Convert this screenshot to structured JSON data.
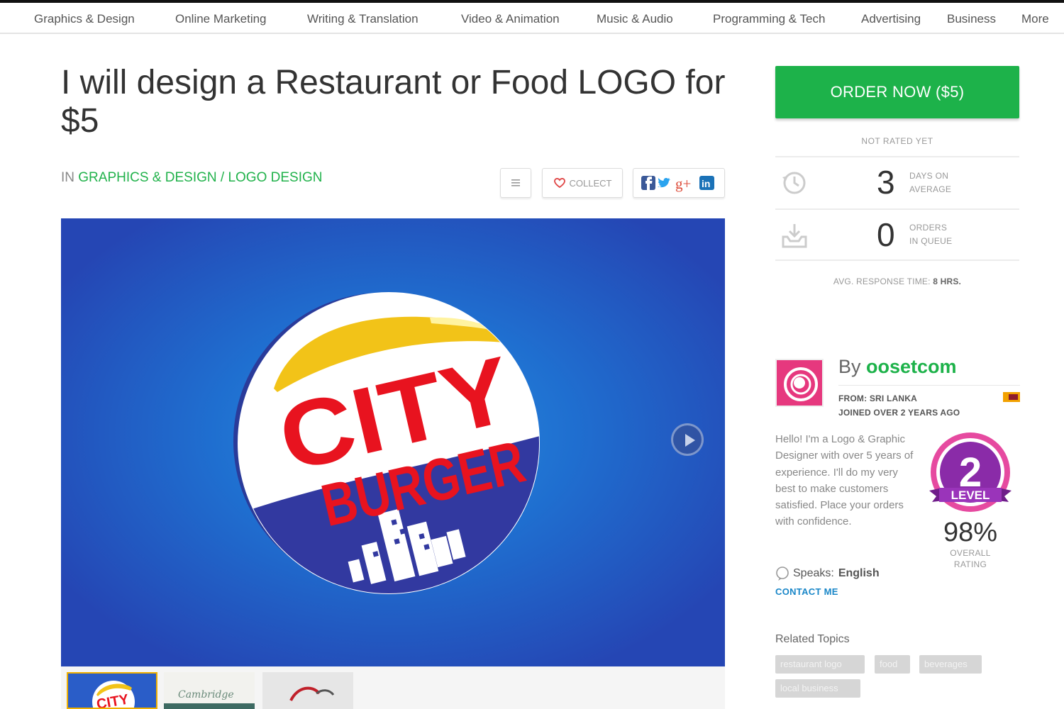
{
  "nav": {
    "items": [
      "Graphics & Design",
      "Online Marketing",
      "Writing & Translation",
      "Video & Animation",
      "Music & Audio",
      "Programming & Tech",
      "Advertising",
      "Business",
      "More"
    ]
  },
  "gig": {
    "title": "I will design a Restaurant or Food LOGO for $5",
    "category_prefix": "IN",
    "category": "GRAPHICS & DESIGN",
    "separator": "/",
    "subcategory": "LOGO DESIGN",
    "collect_label": "COLLECT",
    "share_icons": [
      "facebook-icon",
      "twitter-icon",
      "google-plus-icon",
      "linkedin-icon"
    ],
    "google_plus_text": "g+",
    "linkedin_text": "in"
  },
  "hero": {
    "logo_text_line1": "CITY",
    "logo_text_line2": "BURGER",
    "thumb_logo_text": "CITY",
    "thumb2_script": "Cambridge"
  },
  "order": {
    "button_label": "ORDER NOW ($5)",
    "rating_note": "NOT RATED YET",
    "stats": [
      {
        "value": "3",
        "label_line1": "DAYS ON",
        "label_line2": "AVERAGE",
        "icon": "clock-history-icon"
      },
      {
        "value": "0",
        "label_line1": "ORDERS",
        "label_line2": "IN QUEUE",
        "icon": "inbox-download-icon"
      }
    ],
    "response_prefix": "AVG. RESPONSE TIME:",
    "response_value": "8 HRS."
  },
  "seller": {
    "by": "By",
    "name": "oosetcom",
    "from": "FROM: SRI LANKA",
    "joined": "JOINED OVER 2 YEARS AGO",
    "bio": "Hello! I'm a Logo & Graphic Designer with over 5 years of experience. I'll do my very best to make customers satisfied. Place your orders with confidence.",
    "speaks_label": "Speaks:",
    "speaks_value": "English",
    "contact_label": "CONTACT ME",
    "level_number": "2",
    "level_text": "LEVEL",
    "rating_pct": "98%",
    "rating_label_line1": "OVERALL",
    "rating_label_line2": "RATING"
  },
  "related": {
    "heading": "Related Topics",
    "tags": [
      "restaurant logo",
      "food",
      "beverages",
      "local business"
    ]
  },
  "colors": {
    "accent_green": "#1db24a",
    "link_blue": "#1a87c8",
    "level_purple": "#8a2ba8",
    "hero_blue": "#2546b4"
  }
}
